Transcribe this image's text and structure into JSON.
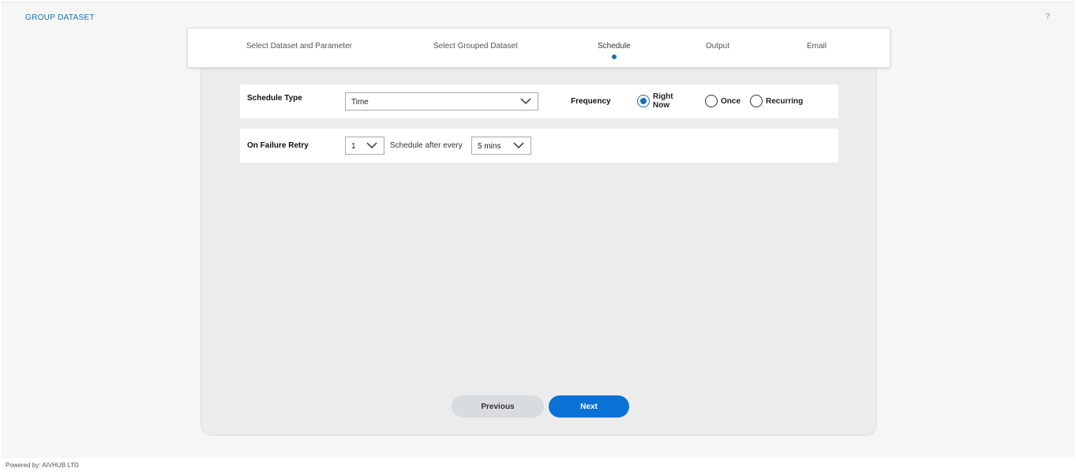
{
  "app": {
    "title": "GROUP DATASET",
    "help_label": "?"
  },
  "steps": [
    {
      "label": "Select Dataset and Parameter",
      "active": false
    },
    {
      "label": "Select Grouped Dataset",
      "active": false
    },
    {
      "label": "Schedule",
      "active": true
    },
    {
      "label": "Output",
      "active": false
    },
    {
      "label": "Email",
      "active": false
    }
  ],
  "schedule": {
    "type_label": "Schedule Type",
    "type_value": "Time",
    "frequency_label": "Frequency",
    "frequency_options": [
      "Right Now",
      "Once",
      "Recurring"
    ],
    "frequency_selected": "Right Now"
  },
  "retry": {
    "label": "On Failure Retry",
    "count_value": "1",
    "after_label": "Schedule after every",
    "interval_value": "5 mins"
  },
  "buttons": {
    "previous": "Previous",
    "next": "Next"
  },
  "footer": {
    "text": "Powered by: AIVHUB LTD"
  },
  "colors": {
    "accent": "#0a72d6",
    "title": "#1a6fb5",
    "panel": "#ececec"
  },
  "icons": {
    "dropdown": "chevron-down-icon",
    "help": "help-icon"
  }
}
